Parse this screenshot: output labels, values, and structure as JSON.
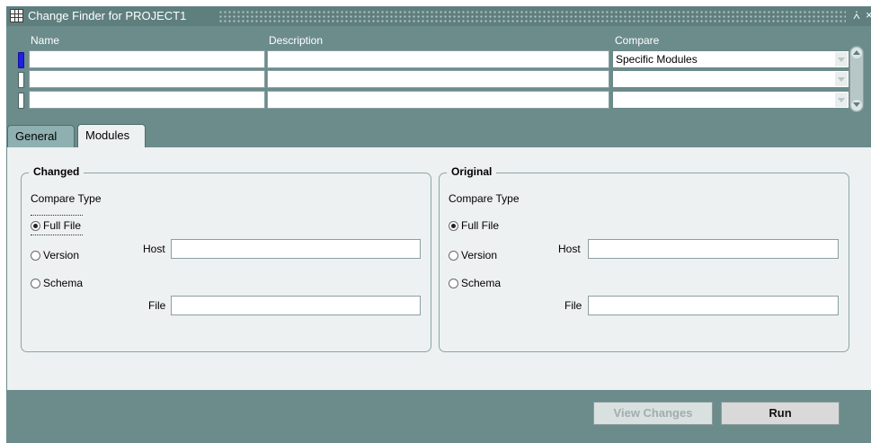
{
  "window": {
    "title": "Change Finder for PROJECT1",
    "icons": {
      "app": "grid-app-icon",
      "minimize": "minimize-icon",
      "close": "close-icon"
    },
    "minimize_glyph": "⩑",
    "close_glyph": "×"
  },
  "columns": {
    "name": "Name",
    "description": "Description",
    "compare": "Compare"
  },
  "rows": [
    {
      "name": "",
      "description": "",
      "compare": "Specific Modules"
    },
    {
      "name": "",
      "description": "",
      "compare": ""
    },
    {
      "name": "",
      "description": "",
      "compare": ""
    }
  ],
  "tabs": {
    "general": "General",
    "modules": "Modules",
    "active": "Modules"
  },
  "changed": {
    "title": "Changed",
    "compare_type_label": "Compare Type",
    "options": {
      "full_file": "Full File",
      "version": "Version",
      "schema": "Schema"
    },
    "selected": "Full File",
    "host_label": "Host",
    "file_label": "File",
    "host_value": "",
    "file_value": ""
  },
  "original": {
    "title": "Original",
    "compare_type_label": "Compare Type",
    "options": {
      "full_file": "Full File",
      "version": "Version",
      "schema": "Schema"
    },
    "selected": "Full File",
    "host_label": "Host",
    "file_label": "File",
    "host_value": "",
    "file_value": ""
  },
  "buttons": {
    "view_changes": "View Changes",
    "run": "Run"
  },
  "colors": {
    "title_bar": "#5f7f7f",
    "canvas": "#6c8c8c",
    "panel": "#eef1f1",
    "current_row": "#2020e0"
  }
}
